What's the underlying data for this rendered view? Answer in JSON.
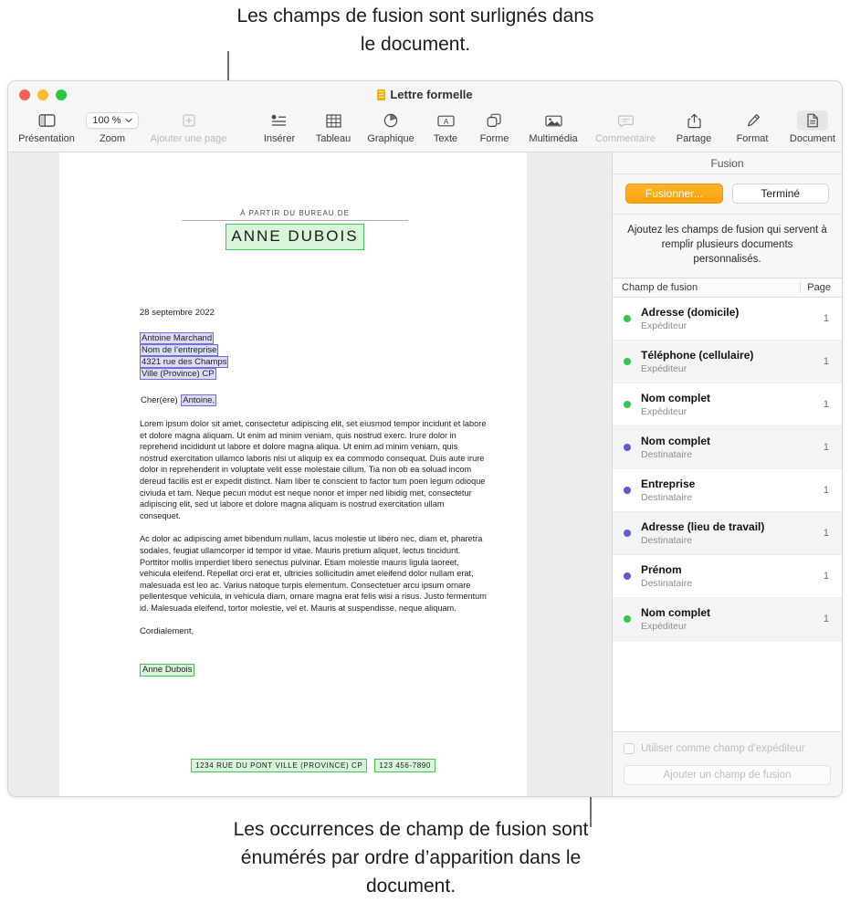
{
  "callouts": {
    "top": "Les champs de fusion sont surlignés dans le document.",
    "bottom": "Les occurrences de champ de fusion sont énumérés par ordre d’apparition dans le document."
  },
  "window": {
    "title": "Lettre formelle",
    "file_icon": "pages-document-icon"
  },
  "toolbar": {
    "left": [
      {
        "label": "Présentation",
        "icon": "sidebar-icon",
        "dim": false
      },
      {
        "label": "Zoom",
        "icon": "zoom-popup",
        "value": "100 %",
        "dim": false
      },
      {
        "label": "Ajouter une page",
        "icon": "add-page-icon",
        "dim": true
      }
    ],
    "center": [
      {
        "label": "Insérer",
        "icon": "insert-icon",
        "dim": false
      },
      {
        "label": "Tableau",
        "icon": "table-icon",
        "dim": false
      },
      {
        "label": "Graphique",
        "icon": "chart-icon",
        "dim": false
      },
      {
        "label": "Texte",
        "icon": "text-box-icon",
        "dim": false
      },
      {
        "label": "Forme",
        "icon": "shape-icon",
        "dim": false
      },
      {
        "label": "Multimédia",
        "icon": "media-icon",
        "dim": false
      },
      {
        "label": "Commentaire",
        "icon": "comment-icon",
        "dim": true
      }
    ],
    "right": [
      {
        "label": "Partage",
        "icon": "share-icon",
        "dim": false
      },
      {
        "label": "Format",
        "icon": "format-brush-icon",
        "dim": false
      },
      {
        "label": "Document",
        "icon": "document-icon",
        "dim": false,
        "active": true
      }
    ]
  },
  "document": {
    "letterhead_sub": "À partir du bureau de",
    "letterhead_name": "ANNE DUBOIS",
    "date": "28 septembre 2022",
    "address_lines": [
      "Antoine Marchand",
      "Nom de l’entreprise",
      "4321 rue des Champs",
      "Ville (Province)  CP"
    ],
    "salutation_prefix": "Cher(ère) ",
    "salutation_field": "Antoine,",
    "paragraph_1": "Lorem ipsum dolor sit amet, consectetur adipiscing elit, set eiusmod tempor incidunt et labore et dolore magna aliquam. Ut enim ad minim veniam, quis nostrud exerc. Irure dolor in reprehend incididunt ut labore et dolore magna aliqua. Ut enim ad minim veniam, quis nostrud exercitation ullamco laboris nisi ut aliquip ex ea commodo consequat. Duis aute irure dolor in reprehenderit in voluptate velit esse molestaie cillum. Tia non ob ea soluad incom dereud facilis est er expedit distinct. Nam liber te conscient to factor tum poen legum odioque civiuda et tam. Neque pecun modut est neque nonor et imper ned libidig met, consectetur adipiscing elit, sed ut labore et dolore magna aliquam is nostrud exercitation ullam consequet.",
    "paragraph_2": "Ac dolor ac adipiscing amet bibendum nullam, lacus molestie ut libero nec, diam et, pharetra sodales, feugiat ullamcorper id tempor id vitae. Mauris pretium aliquet, lectus tincidunt. Porttitor mollis imperdiet libero senectus pulvinar. Etiam molestie mauris ligula laoreet, vehicula eleifend. Repellat orci erat et, ultricies sollicitudin amet eleifend dolor nullam erat, malesuada est leo ac. Varius natoque turpis elementum. Consectetuer arcu ipsum ornare pellentesque vehicula, in vehicula diam, ornare magna erat felis wisi a risus. Justo fermentum id. Malesuada eleifend, tortor molestie, vel et. Mauris at suspendisse, neque aliquam.",
    "closing": "Cordialement,",
    "signature": "Anne Dubois",
    "footer_address": "1234 RUE DU PONT   VILLE (PROVINCE)  CP",
    "footer_phone": "123 456-7890"
  },
  "sidebar": {
    "header": "Fusion",
    "merge_button": "Fusionner...",
    "done_button": "Terminé",
    "description": "Ajoutez les champs de fusion qui servent à remplir plusieurs documents personnalisés.",
    "col_field": "Champ de fusion",
    "col_page": "Page",
    "colors": {
      "sender": "#2fc84a",
      "recipient": "#5b5bd6",
      "accent": "#ffa20d"
    },
    "fields": [
      {
        "name": "Adresse (domicile)",
        "role": "Expéditeur",
        "page": "1",
        "dot": "#2fc84a"
      },
      {
        "name": "Téléphone (cellulaire)",
        "role": "Expéditeur",
        "page": "1",
        "dot": "#2fc84a"
      },
      {
        "name": "Nom complet",
        "role": "Expéditeur",
        "page": "1",
        "dot": "#2fc84a"
      },
      {
        "name": "Nom complet",
        "role": "Destinataire",
        "page": "1",
        "dot": "#5b5bd6"
      },
      {
        "name": "Entreprise",
        "role": "Destinataire",
        "page": "1",
        "dot": "#5b5bd6"
      },
      {
        "name": "Adresse (lieu de travail)",
        "role": "Destinataire",
        "page": "1",
        "dot": "#5b5bd6"
      },
      {
        "name": "Prénom",
        "role": "Destinataire",
        "page": "1",
        "dot": "#5b5bd6"
      },
      {
        "name": "Nom complet",
        "role": "Expéditeur",
        "page": "1",
        "dot": "#2fc84a"
      }
    ],
    "checkbox_label": "Utiliser comme champ d’expéditeur",
    "add_button": "Ajouter un champ de fusion"
  }
}
